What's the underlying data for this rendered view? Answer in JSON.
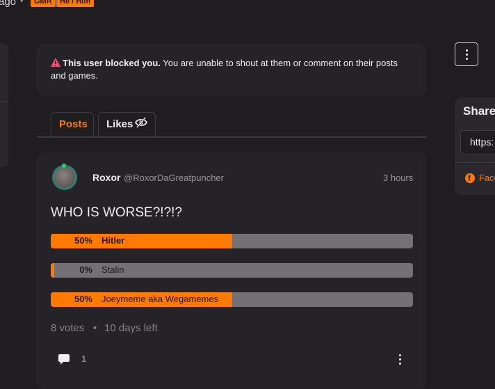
{
  "header": {
    "relative_time": "ago",
    "tags": [
      "GMR",
      "He / Him"
    ]
  },
  "notice": {
    "strong": "This user blocked you.",
    "text": " You are unable to shout at them or comment on their posts and games."
  },
  "tabs": [
    {
      "label": "Posts",
      "active": true
    },
    {
      "label": "Likes",
      "active": false
    }
  ],
  "share": {
    "title": "Share",
    "url_value": "https:",
    "facebook_label": "Face"
  },
  "post": {
    "author": "Roxor",
    "handle": "@RoxorDaGreatpuncher",
    "time": "3 hours",
    "title": "WHO IS WORSE?!?!?",
    "poll": [
      {
        "percent": 50,
        "percent_label": "50%",
        "label": "Hitler",
        "leading": true
      },
      {
        "percent": 0,
        "percent_label": "0%",
        "label": "Stalin",
        "leading": false
      },
      {
        "percent": 50,
        "percent_label": "50%",
        "label": "Joeymeme aka Wegamemes",
        "leading": false
      }
    ],
    "votes": "8 votes",
    "separator": "•",
    "days_left": "10 days left",
    "comment_count": "1"
  },
  "colors": {
    "accent": "#ff7a00",
    "background": "#1f1d20",
    "card": "#252327",
    "poll_track": "#737176",
    "warning": "#ff4d6d"
  }
}
